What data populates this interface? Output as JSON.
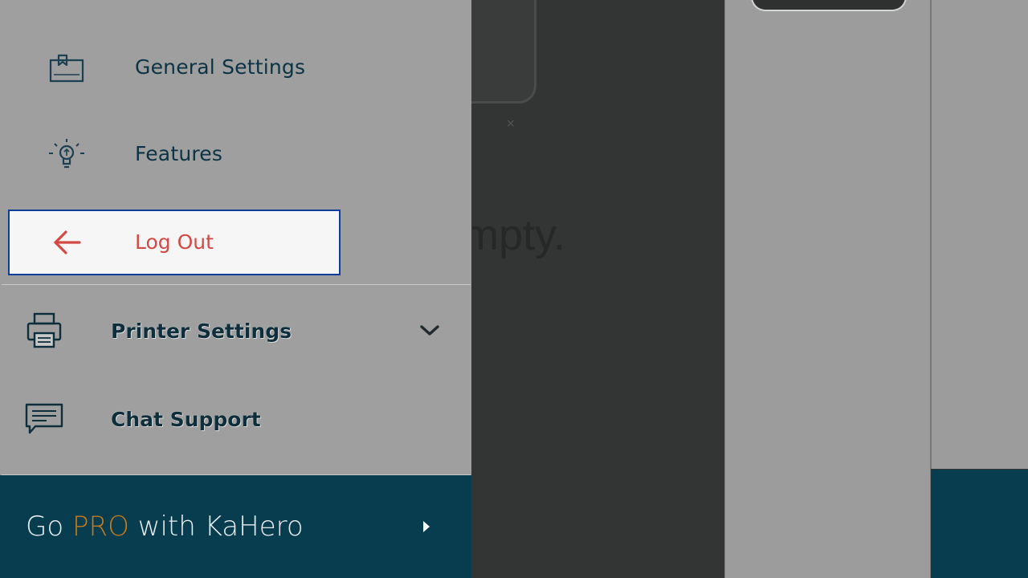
{
  "background": {
    "empty_text": "mpty.",
    "close_glyph": "×"
  },
  "drawer": {
    "items": [
      {
        "label": "General Settings",
        "icon": "settings-folder-icon"
      },
      {
        "label": "Features",
        "icon": "lightbulb-icon"
      },
      {
        "label": "Log Out",
        "icon": "arrow-left-icon"
      }
    ],
    "section2": [
      {
        "label": "Printer Settings",
        "icon": "printer-icon",
        "expand_icon": "chevron-down-icon"
      },
      {
        "label": "Chat Support",
        "icon": "chat-bubble-icon"
      }
    ],
    "pro_banner": {
      "prefix": "Go ",
      "highlight": "PRO",
      "suffix": " with KaHero",
      "arrow_icon": "caret-right-icon"
    }
  },
  "colors": {
    "drawer_bg": "#9f9f9f",
    "logout_text": "#d24a46",
    "focus_border": "#0c3c9c",
    "banner_bg": "#073d4e",
    "pro_accent": "#c37a1c"
  }
}
